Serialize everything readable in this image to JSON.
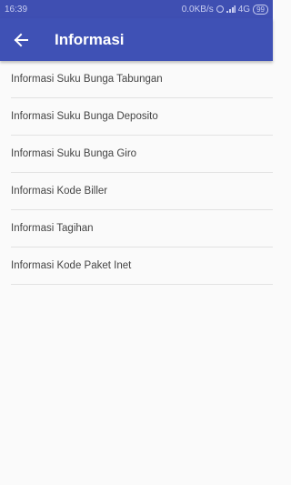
{
  "statusbar": {
    "time": "16:39",
    "speed": "0.0KB/s",
    "network": "4G",
    "battery": "99"
  },
  "appbar": {
    "title": "Informasi",
    "back_icon": "arrow-left-icon"
  },
  "list": {
    "items": [
      {
        "label": "Informasi Suku Bunga Tabungan"
      },
      {
        "label": "Informasi Suku Bunga Deposito"
      },
      {
        "label": "Informasi Suku Bunga Giro"
      },
      {
        "label": "Informasi Kode Biller"
      },
      {
        "label": "Informasi Tagihan"
      },
      {
        "label": "Informasi Kode Paket Inet"
      }
    ]
  },
  "colors": {
    "primary": "#3f51b5",
    "statusbar": "#3f4fb2",
    "background": "#fafafa",
    "divider": "#e2e2e2",
    "text": "#444444"
  }
}
